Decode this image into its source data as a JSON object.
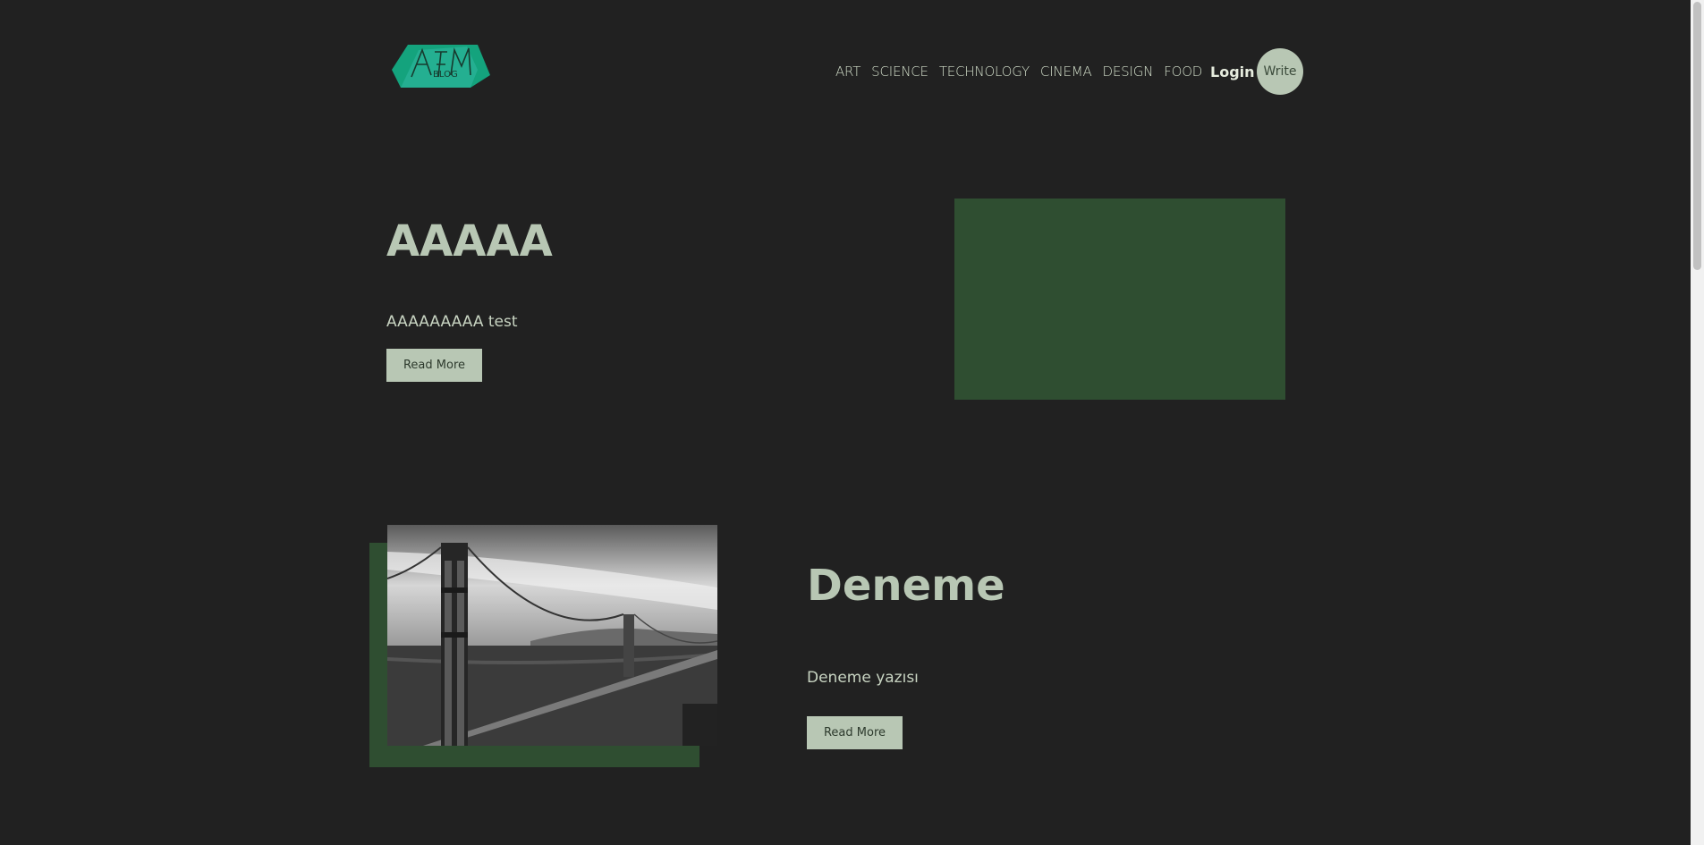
{
  "header": {
    "logo_text": "AFM BLOG",
    "nav": [
      "ART",
      "SCIENCE",
      "TECHNOLOGY",
      "CINEMA",
      "DESIGN",
      "FOOD"
    ],
    "login_label": "Login",
    "write_label": "Write"
  },
  "posts": [
    {
      "title": "AAAAA",
      "description": "AAAAAAAAA test",
      "button_label": "Read More"
    },
    {
      "title": "Deneme",
      "description": "Deneme yazısı",
      "button_label": "Read More"
    }
  ],
  "colors": {
    "background": "#212121",
    "accent_green": "#2f4e31",
    "sage": "#b8c7b4",
    "logo_teal": "#1fa88a"
  }
}
